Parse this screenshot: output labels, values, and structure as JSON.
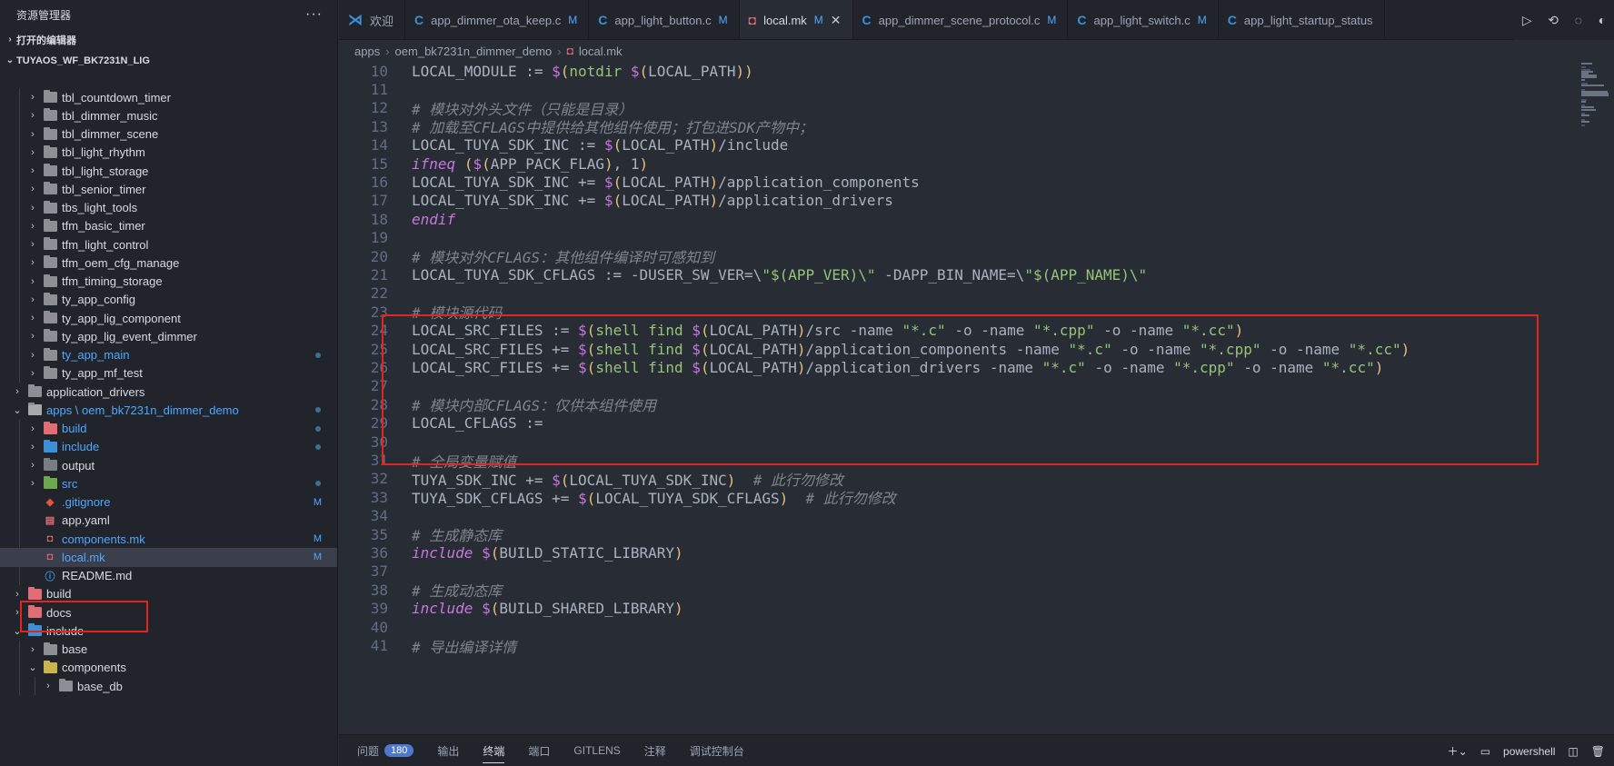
{
  "sidebar": {
    "title": "资源管理器",
    "open_editors": "打开的编辑器",
    "workspace": "TUYAOS_WF_BK7231N_LIG",
    "items": [
      {
        "label": "tbl_countdown_timer",
        "depth": 1,
        "type": "folder"
      },
      {
        "label": "tbl_dimmer_music",
        "depth": 1,
        "type": "folder"
      },
      {
        "label": "tbl_dimmer_scene",
        "depth": 1,
        "type": "folder"
      },
      {
        "label": "tbl_light_rhythm",
        "depth": 1,
        "type": "folder"
      },
      {
        "label": "tbl_light_storage",
        "depth": 1,
        "type": "folder"
      },
      {
        "label": "tbl_senior_timer",
        "depth": 1,
        "type": "folder"
      },
      {
        "label": "tbs_light_tools",
        "depth": 1,
        "type": "folder"
      },
      {
        "label": "tfm_basic_timer",
        "depth": 1,
        "type": "folder"
      },
      {
        "label": "tfm_light_control",
        "depth": 1,
        "type": "folder"
      },
      {
        "label": "tfm_oem_cfg_manage",
        "depth": 1,
        "type": "folder"
      },
      {
        "label": "tfm_timing_storage",
        "depth": 1,
        "type": "folder"
      },
      {
        "label": "ty_app_config",
        "depth": 1,
        "type": "folder"
      },
      {
        "label": "ty_app_lig_component",
        "depth": 1,
        "type": "folder"
      },
      {
        "label": "ty_app_lig_event_dimmer",
        "depth": 1,
        "type": "folder"
      },
      {
        "label": "ty_app_main",
        "depth": 1,
        "type": "folder",
        "modified": true,
        "dot": true
      },
      {
        "label": "ty_app_mf_test",
        "depth": 1,
        "type": "folder"
      },
      {
        "label": "application_drivers",
        "depth": 0,
        "type": "folder"
      },
      {
        "label": "apps \\ oem_bk7231n_dimmer_demo",
        "depth": 0,
        "type": "folder-open",
        "modified": true,
        "dot": true
      },
      {
        "label": "build",
        "depth": 1,
        "type": "folder-red",
        "modified": true,
        "dot": true
      },
      {
        "label": "include",
        "depth": 1,
        "type": "folder-blue",
        "modified": true,
        "dot": true
      },
      {
        "label": "output",
        "depth": 1,
        "type": "folder-gray"
      },
      {
        "label": "src",
        "depth": 1,
        "type": "folder-green",
        "modified": true,
        "dot": true
      },
      {
        "label": ".gitignore",
        "depth": 1,
        "type": "file-git",
        "modified": true,
        "status": "M"
      },
      {
        "label": "app.yaml",
        "depth": 1,
        "type": "file-yaml"
      },
      {
        "label": "components.mk",
        "depth": 1,
        "type": "file-mk",
        "modified": true,
        "status": "M"
      },
      {
        "label": "local.mk",
        "depth": 1,
        "type": "file-mk",
        "modified": true,
        "status": "M",
        "active": true
      },
      {
        "label": "README.md",
        "depth": 1,
        "type": "file-info"
      },
      {
        "label": "build",
        "depth": 0,
        "type": "folder-red"
      },
      {
        "label": "docs",
        "depth": 0,
        "type": "folder-red"
      },
      {
        "label": "include",
        "depth": 0,
        "type": "folder-blue-open"
      },
      {
        "label": "base",
        "depth": 1,
        "type": "folder"
      },
      {
        "label": "components",
        "depth": 1,
        "type": "folder-yellow-open"
      },
      {
        "label": "base_db",
        "depth": 2,
        "type": "folder"
      }
    ]
  },
  "tabs": [
    {
      "label": "欢迎",
      "icon": "vscode-icon"
    },
    {
      "label": "app_dimmer_ota_keep.c",
      "status": "M",
      "icon": "c-file-icon"
    },
    {
      "label": "app_light_button.c",
      "status": "M",
      "icon": "c-file-icon"
    },
    {
      "label": "local.mk",
      "status": "M",
      "icon": "makefile-icon",
      "active": true
    },
    {
      "label": "app_dimmer_scene_protocol.c",
      "status": "M",
      "icon": "c-file-icon"
    },
    {
      "label": "app_light_switch.c",
      "status": "M",
      "icon": "c-file-icon"
    },
    {
      "label": "app_light_startup_status",
      "icon": "c-file-icon"
    }
  ],
  "breadcrumb": [
    "apps",
    "oem_bk7231n_dimmer_demo",
    "local.mk"
  ],
  "editor": {
    "lines": [
      {
        "n": "10",
        "t": "LOCAL_MODULE := $(notdir $(LOCAL_PATH))"
      },
      {
        "n": "11",
        "t": ""
      },
      {
        "n": "12",
        "t": "# 模块对外头文件（只能是目录）"
      },
      {
        "n": "13",
        "t": "# 加载至CFLAGS中提供给其他组件使用；打包进SDK产物中；"
      },
      {
        "n": "14",
        "t": "LOCAL_TUYA_SDK_INC := $(LOCAL_PATH)/include"
      },
      {
        "n": "15",
        "t": "ifneq ($(APP_PACK_FLAG), 1)"
      },
      {
        "n": "16",
        "t": "LOCAL_TUYA_SDK_INC += $(LOCAL_PATH)/application_components"
      },
      {
        "n": "17",
        "t": "LOCAL_TUYA_SDK_INC += $(LOCAL_PATH)/application_drivers"
      },
      {
        "n": "18",
        "t": "endif"
      },
      {
        "n": "19",
        "t": ""
      },
      {
        "n": "20",
        "t": "# 模块对外CFLAGS：其他组件编译时可感知到"
      },
      {
        "n": "21",
        "t": "LOCAL_TUYA_SDK_CFLAGS := -DUSER_SW_VER=\\\"$(APP_VER)\\\" -DAPP_BIN_NAME=\\\"$(APP_NAME)\\\""
      },
      {
        "n": "22",
        "t": ""
      },
      {
        "n": "23",
        "t": "# 模块源代码"
      },
      {
        "n": "24",
        "t": "LOCAL_SRC_FILES := $(shell find $(LOCAL_PATH)/src -name \"*.c\" -o -name \"*.cpp\" -o -name \"*.cc\")"
      },
      {
        "n": "25",
        "t": "LOCAL_SRC_FILES += $(shell find $(LOCAL_PATH)/application_components -name \"*.c\" -o -name \"*.cpp\" -o -name \"*.cc\")"
      },
      {
        "n": "26",
        "t": "LOCAL_SRC_FILES += $(shell find $(LOCAL_PATH)/application_drivers -name \"*.c\" -o -name \"*.cpp\" -o -name \"*.cc\")"
      },
      {
        "n": "27",
        "t": ""
      },
      {
        "n": "28",
        "t": "# 模块内部CFLAGS：仅供本组件使用"
      },
      {
        "n": "29",
        "t": "LOCAL_CFLAGS :="
      },
      {
        "n": "30",
        "t": ""
      },
      {
        "n": "31",
        "t": "# 全局变量赋值"
      },
      {
        "n": "32",
        "t": "TUYA_SDK_INC += $(LOCAL_TUYA_SDK_INC)  # 此行勿修改"
      },
      {
        "n": "33",
        "t": "TUYA_SDK_CFLAGS += $(LOCAL_TUYA_SDK_CFLAGS)  # 此行勿修改"
      },
      {
        "n": "34",
        "t": ""
      },
      {
        "n": "35",
        "t": "# 生成静态库"
      },
      {
        "n": "36",
        "t": "include $(BUILD_STATIC_LIBRARY)"
      },
      {
        "n": "37",
        "t": ""
      },
      {
        "n": "38",
        "t": "# 生成动态库"
      },
      {
        "n": "39",
        "t": "include $(BUILD_SHARED_LIBRARY)"
      },
      {
        "n": "40",
        "t": ""
      },
      {
        "n": "41",
        "t": "# 导出编译详情"
      }
    ]
  },
  "panel": {
    "tabs": [
      {
        "label": "问题",
        "badge": "180"
      },
      {
        "label": "输出"
      },
      {
        "label": "终端",
        "active": true
      },
      {
        "label": "端口"
      },
      {
        "label": "GITLENS"
      },
      {
        "label": "注释"
      },
      {
        "label": "调试控制台"
      }
    ],
    "terminal": "powershell"
  },
  "colors": {
    "highlight_box": "#e0261f",
    "modified": "#4fa7ff",
    "editor_bg": "#282c34"
  }
}
